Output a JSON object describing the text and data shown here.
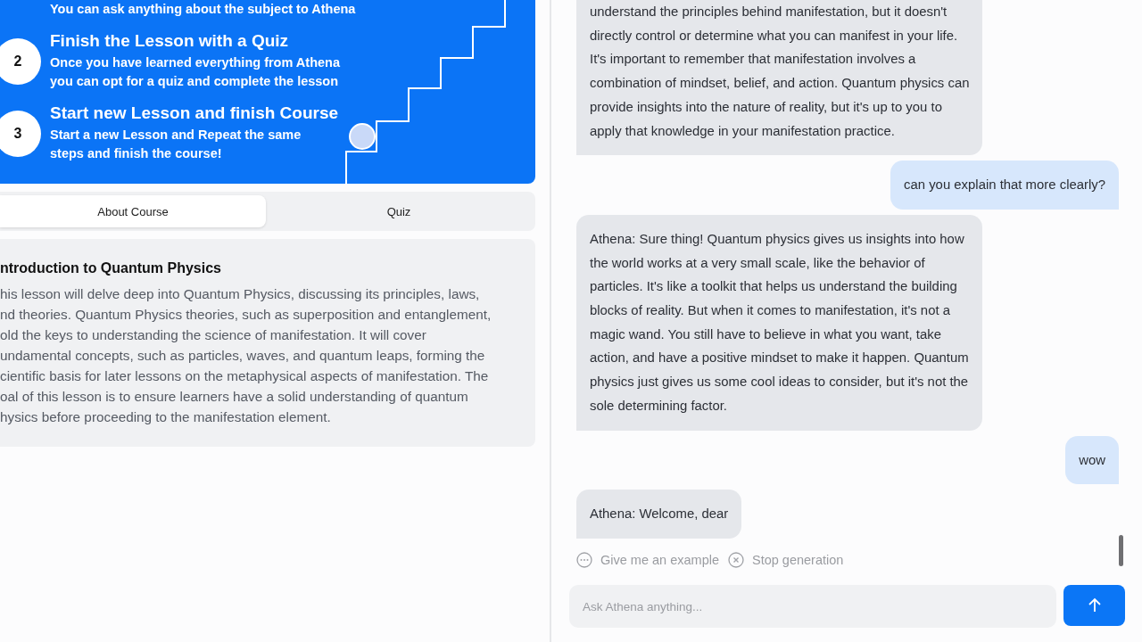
{
  "lesson_steps": [
    {
      "description": "You can ask anything about the subject to Athena"
    },
    {
      "number": "2",
      "title": "Finish the Lesson with a Quiz",
      "description": "Once you have learned everything from Athena\nyou can opt for a quiz and complete the lesson"
    },
    {
      "number": "3",
      "title": "Start new Lesson and finish Course",
      "description": "Start a new Lesson and Repeat the same\nsteps and finish the course!"
    }
  ],
  "tabs": [
    {
      "label": "About Course",
      "selected": true
    },
    {
      "label": "Quiz",
      "selected": false
    }
  ],
  "about": {
    "title": "ntroduction to Quantum Physics",
    "body": "his lesson will delve deep into Quantum Physics, discussing its principles, laws,\nnd theories. Quantum Physics theories, such as superposition and entanglement,\nold the keys to understanding the science of manifestation. It will cover\nundamental concepts, such as particles, waves, and quantum leaps, forming the\ncientific basis for later lessons on the metaphysical aspects of manifestation. The\noal of this lesson is to ensure learners have a solid understanding of quantum\nhysics before proceeding to the manifestation element."
  },
  "messages": [
    {
      "kind": "assistant",
      "text": "understand the principles behind manifestation, but it doesn't\ndirectly control or determine what you can manifest in your life.\nIt's important to remember that manifestation involves a\ncombination of mindset, belief, and action. Quantum physics can\nprovide insights into the nature of reality, but it's up to you to\napply that knowledge in your manifestation practice."
    },
    {
      "kind": "user",
      "text": "can you explain that more clearly?"
    },
    {
      "kind": "assistant",
      "text": "Athena: Sure thing! Quantum physics gives us insights into how\nthe world works at a very small scale, like the behavior of\nparticles. It's like a toolkit that helps us understand the building\nblocks of reality. But when it comes to manifestation, it's not a\nmagic wand. You still have to believe in what you want, take\naction, and have a positive mindset to make it happen. Quantum\nphysics just gives us some cool ideas to consider, but it's not the\nsole determining factor."
    },
    {
      "kind": "user",
      "text": "wow"
    },
    {
      "kind": "assistant",
      "text": "Athena: Welcome, dear"
    }
  ],
  "suggestions": [
    {
      "kind": "more",
      "label": "Give me an example"
    },
    {
      "kind": "stop",
      "label": "Stop generation"
    }
  ],
  "input": {
    "placeholder": "Ask Athena anything..."
  }
}
